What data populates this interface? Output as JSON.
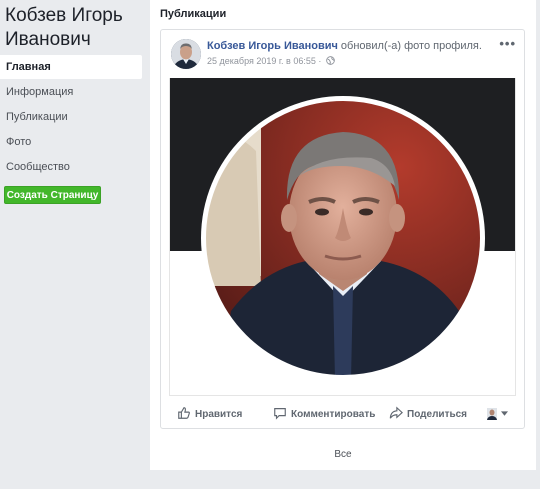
{
  "page": {
    "name": "Кобзев Игорь Иванович"
  },
  "sidebar": {
    "items": [
      {
        "label": "Главная",
        "active": true
      },
      {
        "label": "Информация"
      },
      {
        "label": "Публикации"
      },
      {
        "label": "Фото"
      },
      {
        "label": "Сообщество"
      }
    ],
    "create_page_label": "Создать Страницу"
  },
  "main": {
    "section_title": "Публикации",
    "post": {
      "author": "Кобзев Игорь Иванович",
      "action": "обновил(-а) фото профиля.",
      "timestamp": "25 декабря 2019 г. в 06:55",
      "separator": "·",
      "privacy_icon": "globe-icon",
      "more_label": "•••"
    },
    "actions": {
      "like": "Нравится",
      "comment": "Комментировать",
      "share": "Поделиться"
    },
    "see_all": "Все"
  },
  "colors": {
    "background": "#e9ebee",
    "link": "#385898",
    "create_button": "#42b72a",
    "photo_band": "#1e1f22"
  }
}
